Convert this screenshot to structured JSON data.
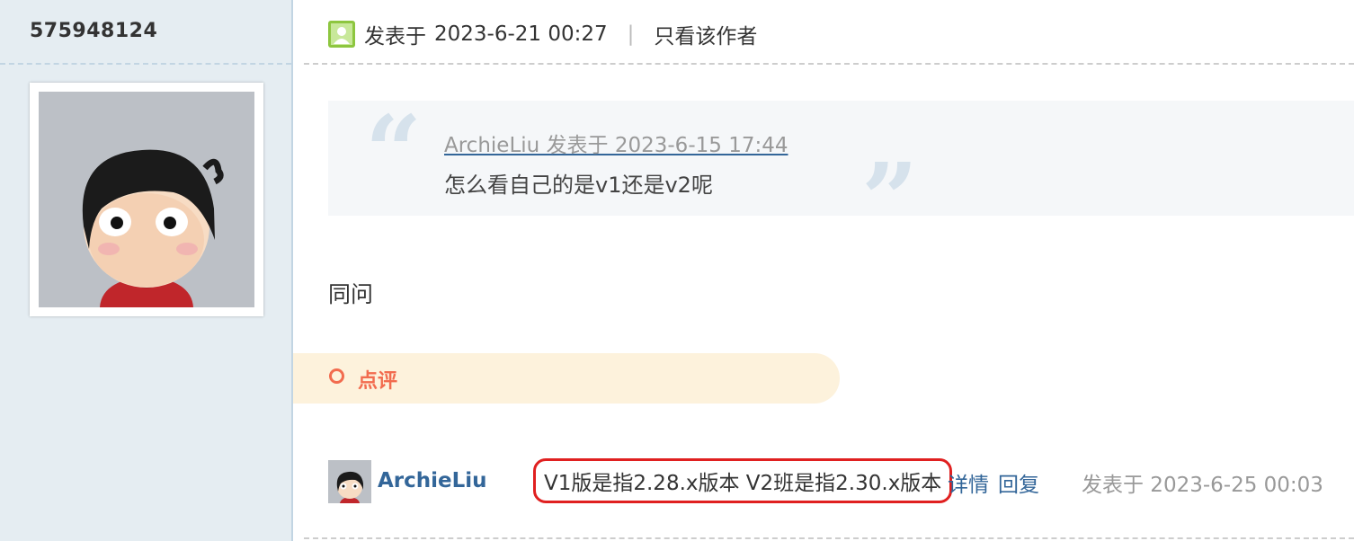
{
  "author": {
    "username": "575948124"
  },
  "post": {
    "posted_prefix": "发表于",
    "posted_time": "2023-6-21 00:27",
    "separator": "|",
    "only_author_link": "只看该作者",
    "quote": {
      "open_mark": "“",
      "close_mark": "”",
      "meta": "ArchieLiu 发表于 2023-6-15 17:44",
      "text": "怎么看自己的是v1还是v2呢"
    },
    "body": "同问"
  },
  "comments_section": {
    "label": "点评",
    "accent_color": "#f26c4f",
    "items": [
      {
        "user": "ArchieLiu",
        "text": "V1版是指2.28.x版本 V2班是指2.30.x版本",
        "detail_link": "详情",
        "reply_link": "回复",
        "posted": "发表于 2023-6-25 00:03"
      }
    ]
  },
  "colors": {
    "link": "#336699",
    "highlight_border": "#e02020",
    "sidebar_bg": "#e5edf2"
  }
}
